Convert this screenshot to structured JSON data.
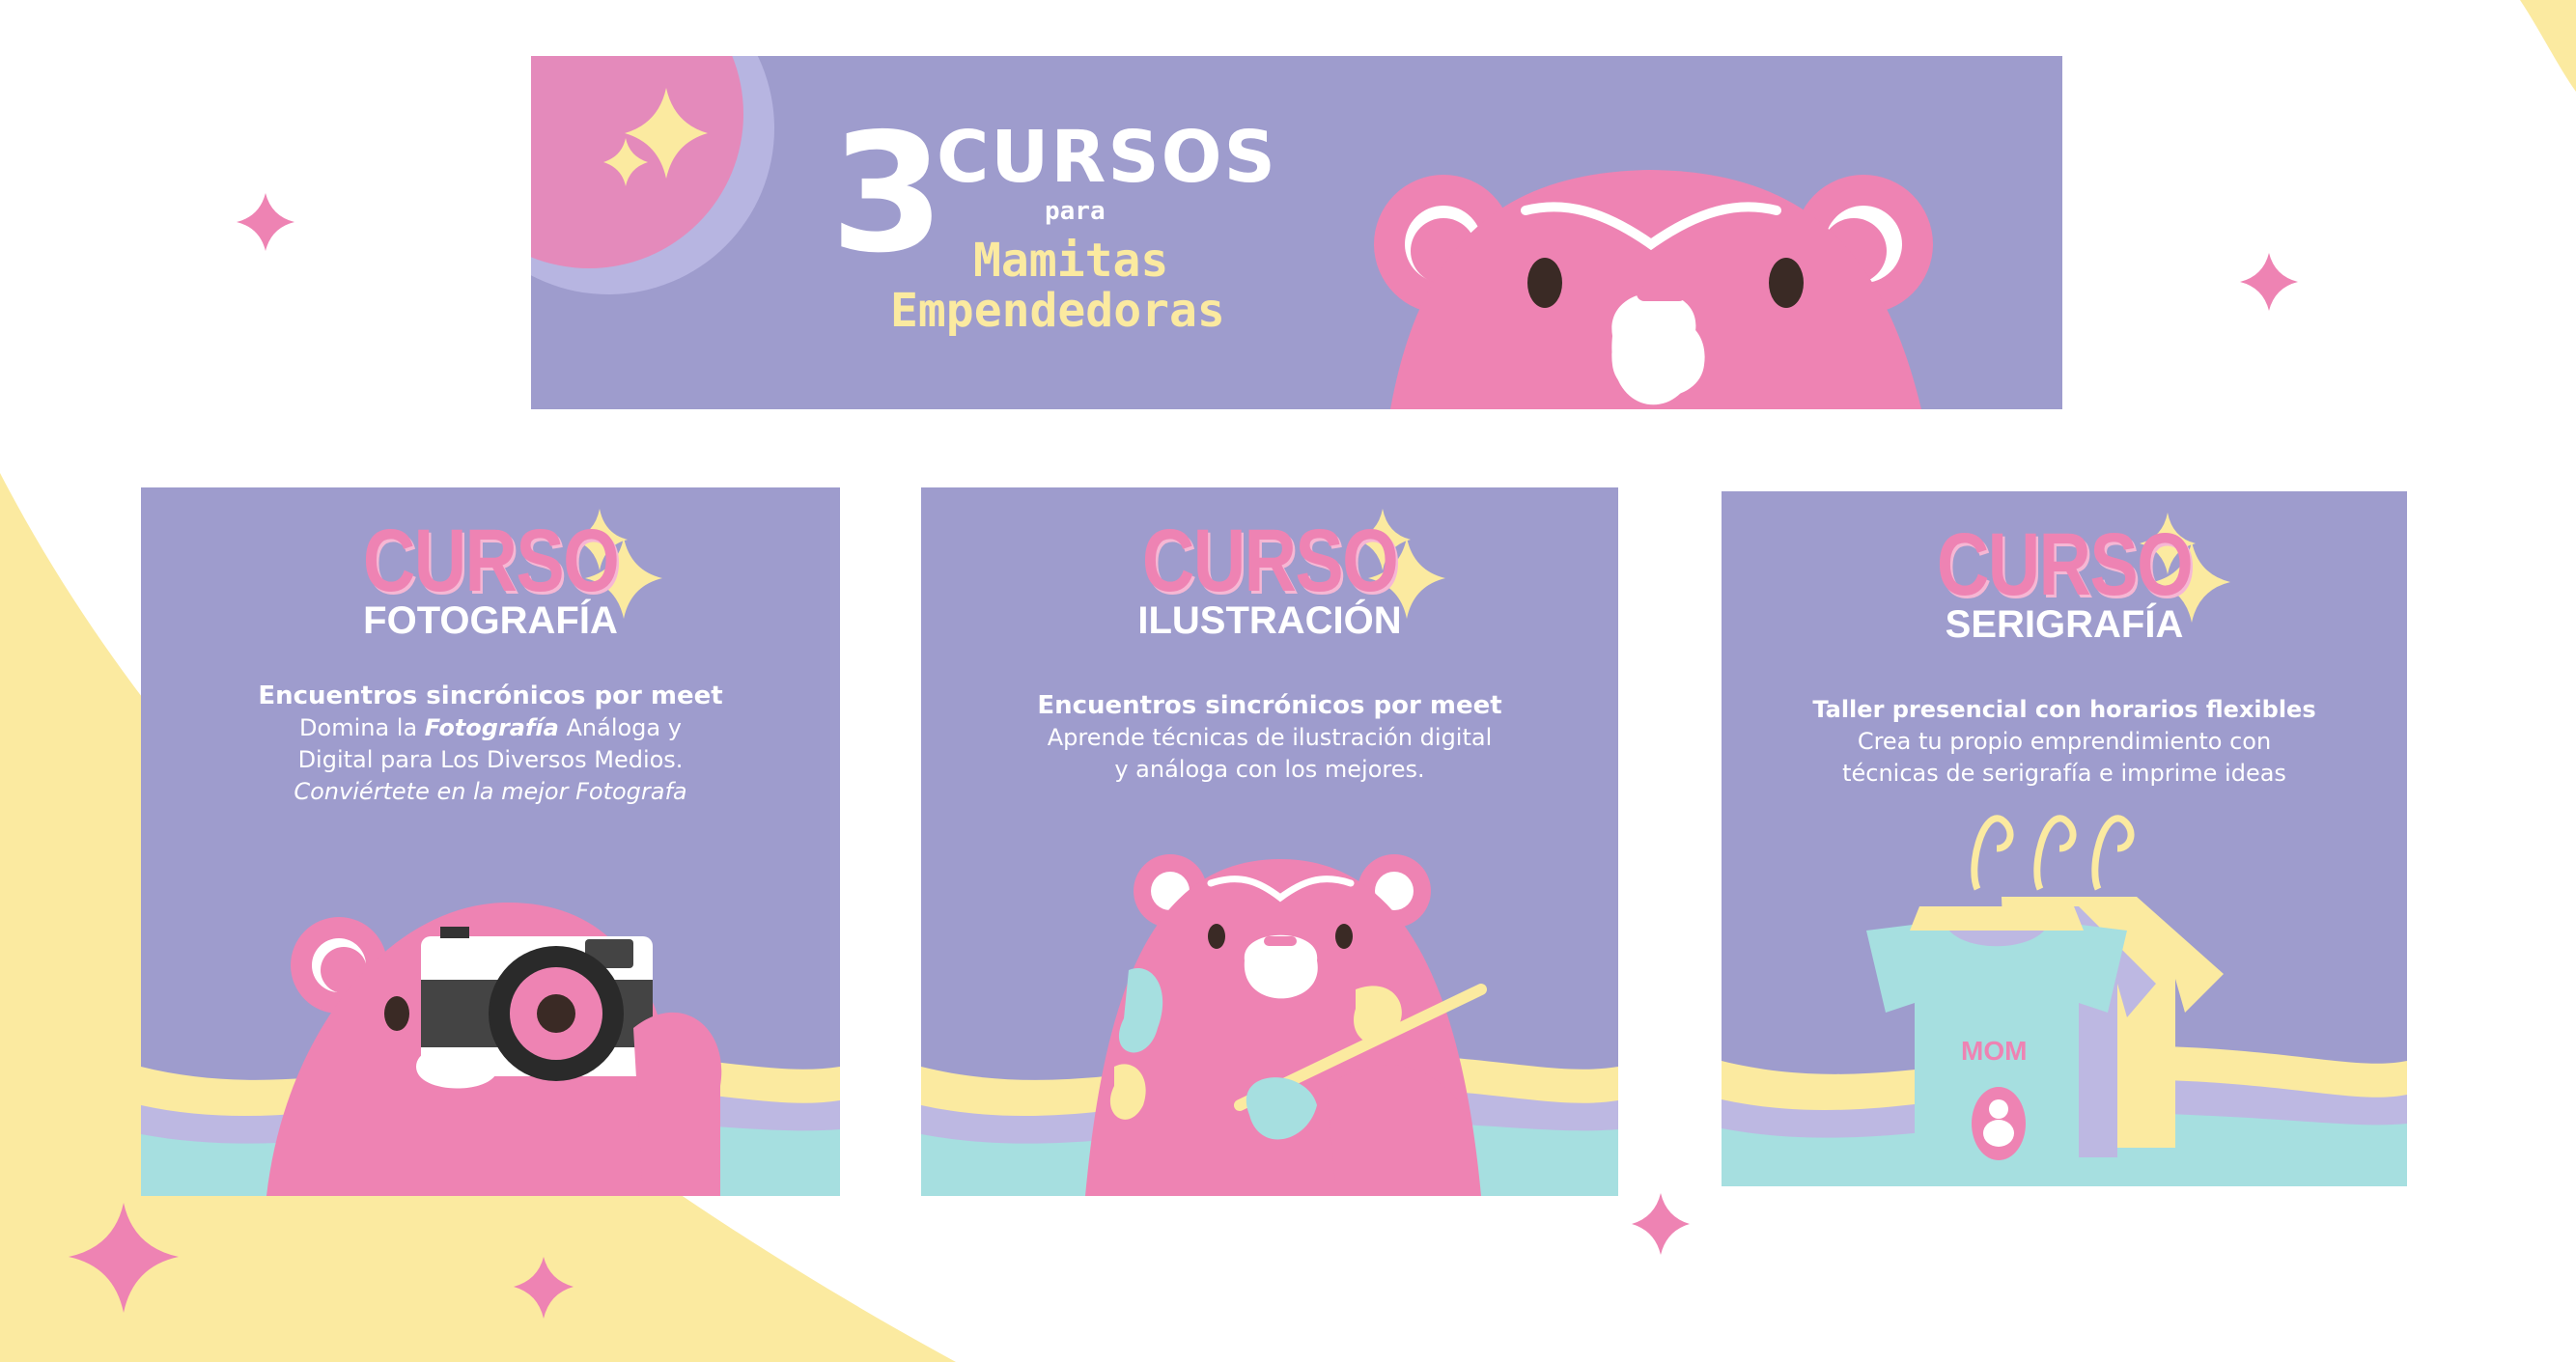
{
  "colors": {
    "lavender": "#9e9ccd",
    "pink": "#ee83b3",
    "yellow": "#fbeaa0",
    "mint": "#a6dfe0",
    "white": "#ffffff"
  },
  "banner": {
    "number": "3",
    "title": "CURSOS",
    "connector": "para",
    "subtitle_line1": "Mamitas",
    "subtitle_line2": "Empendedoras"
  },
  "courses": [
    {
      "kicker": "CURSO",
      "name": "FOTOGRAFÍA",
      "mode": "Encuentros sincrónicos por meet",
      "line1_pre": "Domina la ",
      "line1_em": "Fotografía",
      "line1_post": " Análoga y",
      "line2": "Digital para Los Diversos Medios.",
      "line3": "Conviértete en la mejor Fotografa",
      "illustration": "bear-with-camera"
    },
    {
      "kicker": "CURSO",
      "name": "ILUSTRACIÓN",
      "mode": "Encuentros sincrónicos por meet",
      "line1": "Aprende técnicas de ilustración digital",
      "line2": "y análoga con los mejores.",
      "illustration": "bear-with-paintbrush"
    },
    {
      "kicker": "CURSO",
      "name": "SERIGRAFÍA",
      "mode": "Taller presencial con horarios flexibles",
      "line1": "Crea tu propio emprendimiento con",
      "line2": "técnicas de serigrafía e imprime ideas",
      "illustration": "shirts-on-hangers",
      "shirt_label": "MOM"
    }
  ],
  "decorations": [
    "sparkle-icon",
    "moon-shape"
  ]
}
